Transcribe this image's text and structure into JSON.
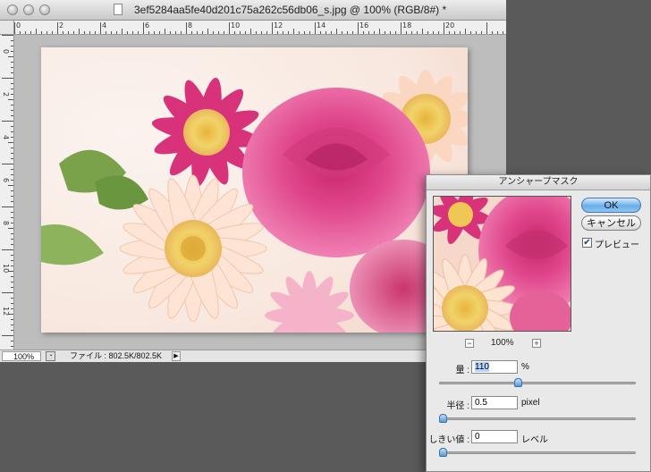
{
  "document": {
    "title": "3ef5284aa5fe40d201c75a262c56db06_s.jpg @ 100% (RGB/8#) *",
    "zoom": "100%",
    "file_info": "ファイル : 802.5K/802.5K",
    "hruler_ticks": [
      "0",
      "2",
      "4",
      "6",
      "8",
      "10",
      "12",
      "14",
      "16",
      "18",
      "20"
    ],
    "vruler_ticks": [
      "0",
      "2",
      "4",
      "6",
      "8",
      "10",
      "12"
    ]
  },
  "dialog": {
    "title": "アンシャープマスク",
    "ok_label": "OK",
    "cancel_label": "キャンセル",
    "preview_label": "プレビュー",
    "preview_checked": true,
    "preview_zoom": "100%",
    "zoom_minus": "−",
    "zoom_plus": "+",
    "params": {
      "amount": {
        "label": "量 :",
        "value": "110",
        "unit": "%",
        "level": 0.4
      },
      "radius": {
        "label": "半径 :",
        "value": "0.5",
        "unit": "pixel",
        "level": 0.0
      },
      "threshold": {
        "label": "しきい値 :",
        "value": "0",
        "unit": "レベル",
        "level": 0.0
      }
    }
  },
  "colors": {
    "workspace": "#5a5a5a",
    "ok_button": "#6aaee9",
    "rose": "#e0478c",
    "gerbera": "#f8d2b8"
  }
}
